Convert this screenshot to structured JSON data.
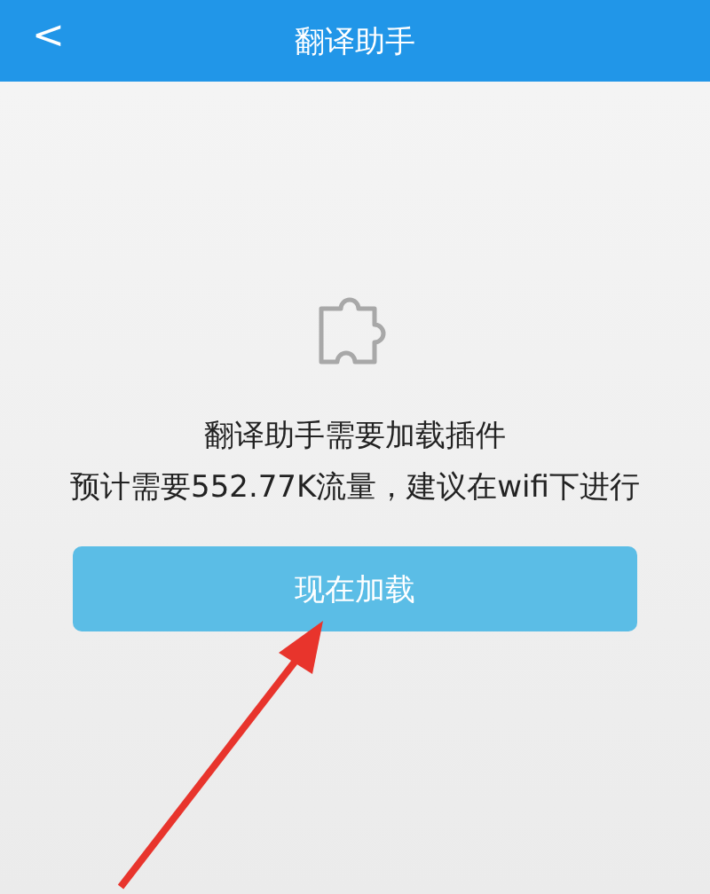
{
  "header": {
    "back": "<",
    "title": "翻译助手"
  },
  "message": {
    "lines": [
      "翻译助手需要加载插件",
      "预计需要552.77K流量，建议在wifi下进行"
    ]
  },
  "buttons": [
    {
      "label": "现在加载"
    }
  ]
}
